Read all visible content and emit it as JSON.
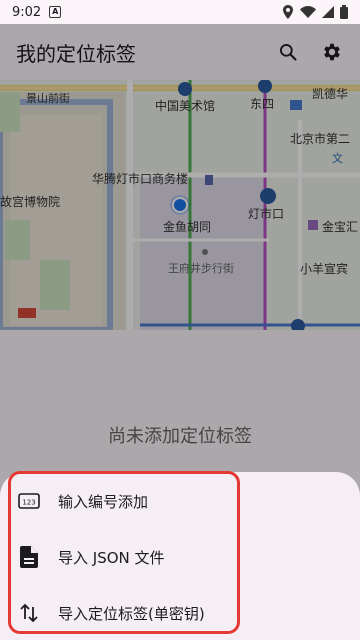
{
  "status_bar": {
    "time": "9:02",
    "notification_icon": "A"
  },
  "app_bar": {
    "title": "我的定位标签",
    "search_icon": "search-icon",
    "settings_icon": "gear-icon"
  },
  "map": {
    "labels": {
      "jingshanqianjie": "景山前街",
      "meishuguan": "中国美术馆",
      "dongsi": "东四",
      "kaidi": "凯德华",
      "beijingshi": "北京市第二",
      "wen": "文",
      "huateng": "华腾灯市口商务楼",
      "gugong": "故宫博物院",
      "jinyu": "金鱼胡同",
      "dengshikou": "灯市口",
      "jinbaojie": "金宝汇",
      "wangfujing": "王府井步行街",
      "xiaoyang": "小羊宣宾"
    }
  },
  "empty_state": {
    "text": "尚未添加定位标签"
  },
  "sheet": {
    "items": [
      {
        "icon": "dialpad-123-icon",
        "label": "输入编号添加"
      },
      {
        "icon": "file-icon",
        "label": "导入 JSON 文件"
      },
      {
        "icon": "swap-vertical-icon",
        "label": "导入定位标签(单密钥)"
      }
    ]
  },
  "colors": {
    "highlight": "#e53935",
    "sheet_bg": "#f5eef4",
    "location_dot": "#1a73e8"
  }
}
